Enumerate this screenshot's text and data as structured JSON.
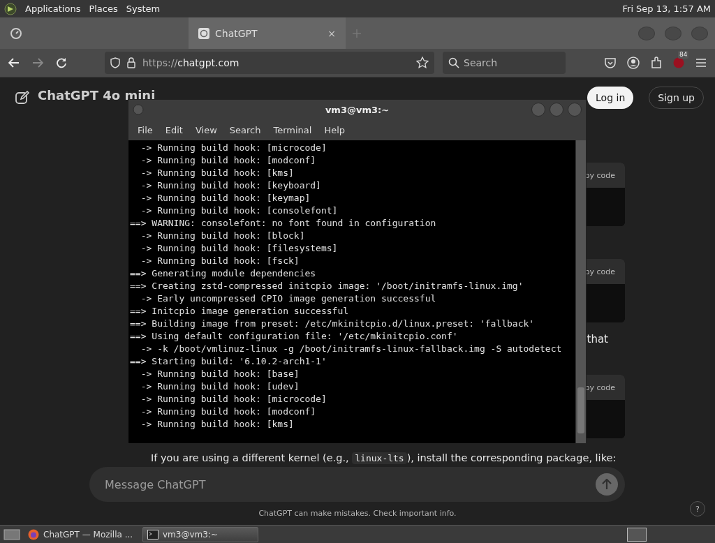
{
  "top_panel": {
    "menus": [
      "Applications",
      "Places",
      "System"
    ],
    "clock": "Fri Sep 13,  1:57 AM"
  },
  "browser": {
    "tabs": [
      {
        "kind": "blurred",
        "selected": false
      },
      {
        "kind": "page",
        "title": "ChatGPT",
        "close": "×",
        "selected": true
      }
    ],
    "url": {
      "scheme": "https://",
      "host": "chatgpt.com"
    },
    "search": {
      "placeholder": "Search"
    },
    "extension_badge": "84"
  },
  "chat": {
    "model": "ChatGPT 4o mini",
    "login": "Log in",
    "signup": "Sign up",
    "blocks": [
      {
        "kind": "code",
        "copy_label": "py code"
      },
      {
        "kind": "code",
        "copy_label": "py code"
      },
      {
        "kind": "text",
        "text": "that"
      },
      {
        "kind": "code",
        "copy_label": "py code"
      },
      {
        "kind": "paragraph",
        "parts": [
          {
            "kind": "text",
            "text": "If you are using a different kernel (e.g., "
          },
          {
            "kind": "code",
            "text": "linux-lts"
          },
          {
            "kind": "text",
            "text": "), install the corresponding package, like:"
          }
        ]
      }
    ],
    "composer": {
      "placeholder": "Message ChatGPT"
    },
    "disclaimer": "ChatGPT can make mistakes. Check important info.",
    "help": "?"
  },
  "terminal": {
    "title": "vm3@vm3:~",
    "menu": [
      "File",
      "Edit",
      "View",
      "Search",
      "Terminal",
      "Help"
    ],
    "lines": [
      "  -> Running build hook: [microcode]",
      "  -> Running build hook: [modconf]",
      "  -> Running build hook: [kms]",
      "  -> Running build hook: [keyboard]",
      "  -> Running build hook: [keymap]",
      "  -> Running build hook: [consolefont]",
      "==> WARNING: consolefont: no font found in configuration",
      "  -> Running build hook: [block]",
      "  -> Running build hook: [filesystems]",
      "  -> Running build hook: [fsck]",
      "==> Generating module dependencies",
      "==> Creating zstd-compressed initcpio image: '/boot/initramfs-linux.img'",
      "  -> Early uncompressed CPIO image generation successful",
      "==> Initcpio image generation successful",
      "==> Building image from preset: /etc/mkinitcpio.d/linux.preset: 'fallback'",
      "==> Using default configuration file: '/etc/mkinitcpio.conf'",
      "  -> -k /boot/vmlinuz-linux -g /boot/initramfs-linux-fallback.img -S autodetect",
      "==> Starting build: '6.10.2-arch1-1'",
      "  -> Running build hook: [base]",
      "  -> Running build hook: [udev]",
      "  -> Running build hook: [microcode]",
      "  -> Running build hook: [modconf]",
      "  -> Running build hook: [kms]"
    ]
  },
  "taskbar": {
    "items": [
      {
        "kind": "browser",
        "label": "ChatGPT — Mozilla ...",
        "selected": false
      },
      {
        "kind": "terminal",
        "label": "vm3@vm3:~",
        "selected": true
      }
    ]
  }
}
